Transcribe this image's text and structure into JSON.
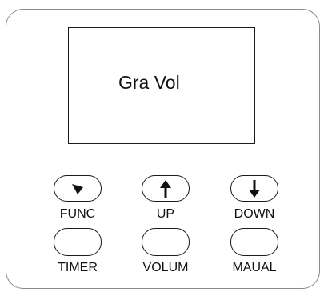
{
  "display": {
    "text": "Gra Vol"
  },
  "keys": {
    "func": {
      "label": "FUNC",
      "icon": "triangle-down-icon"
    },
    "up": {
      "label": "UP",
      "icon": "arrow-up-icon"
    },
    "down": {
      "label": "DOWN",
      "icon": "arrow-down-icon"
    },
    "timer": {
      "label": "TIMER"
    },
    "volum": {
      "label": "VOLUM"
    },
    "maual": {
      "label": "MAUAL"
    }
  },
  "colors": {
    "panel_border": "#8a8a8a",
    "stroke": "#1a1a1a",
    "background": "#ffffff"
  }
}
